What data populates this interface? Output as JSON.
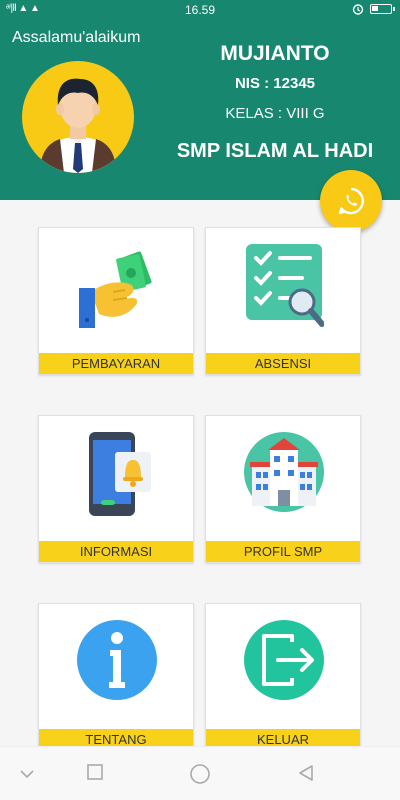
{
  "status_bar": {
    "signal": "ᵃⁱ|ll ▲ ▲",
    "time": "16.59"
  },
  "header": {
    "greeting": "Assalamu'alaikum",
    "name": "MUJIANTO",
    "nis": "NIS : 12345",
    "kelas": "KELAS : VIII G",
    "school": "SMP ISLAM AL HADI"
  },
  "menu": [
    {
      "label": "PEMBAYARAN",
      "icon": "money-hand-icon"
    },
    {
      "label": "ABSENSI",
      "icon": "checklist-icon"
    },
    {
      "label": "INFORMASI",
      "icon": "phone-notification-icon"
    },
    {
      "label": "PROFIL SMP",
      "icon": "school-building-icon"
    },
    {
      "label": "TENTANG",
      "icon": "info-icon"
    },
    {
      "label": "KELUAR",
      "icon": "logout-icon"
    }
  ],
  "colors": {
    "primary": "#17886f",
    "accent": "#f8d21a"
  }
}
